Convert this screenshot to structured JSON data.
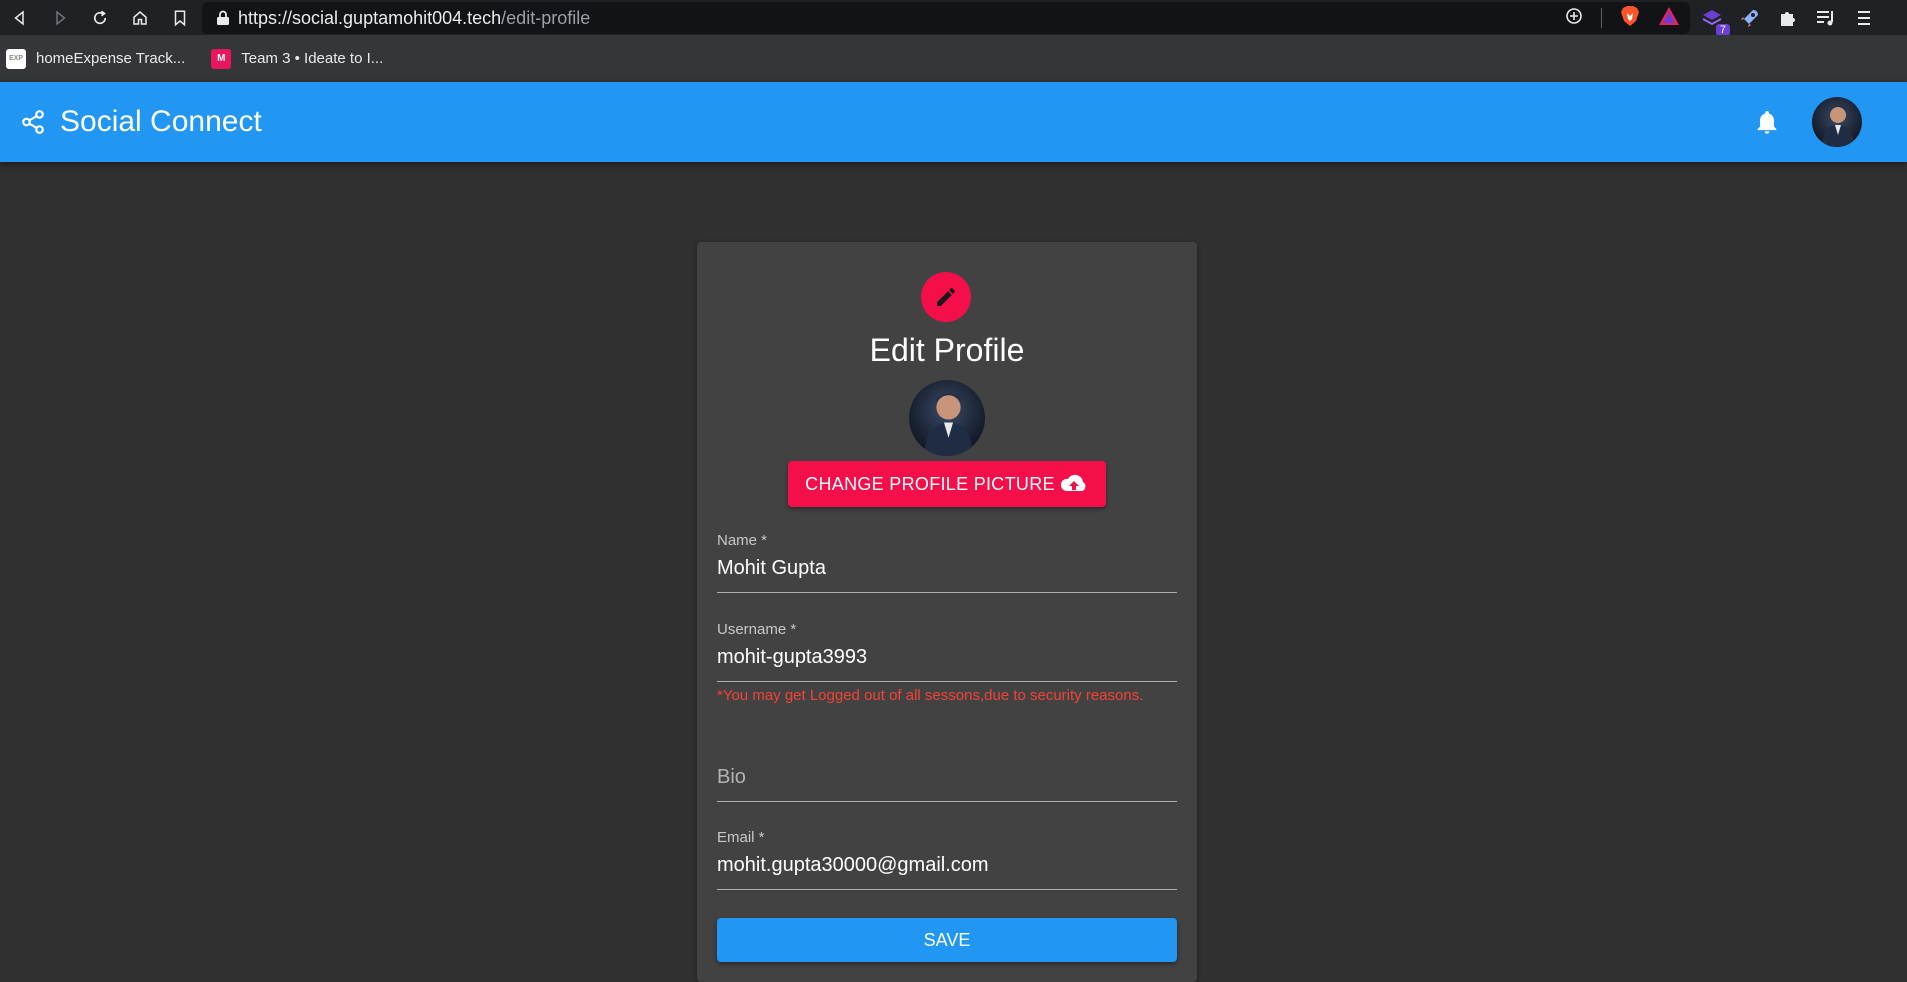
{
  "browser": {
    "url_host": "https://social.guptamohit004.tech",
    "url_path": "/edit-profile",
    "extension_badge": "7",
    "bookmarks": [
      {
        "label": "homeExpense Track...",
        "icon_text": "EXP"
      },
      {
        "label": "Team 3 • Ideate to I...",
        "icon_text": "M"
      }
    ]
  },
  "appbar": {
    "title": "Social Connect"
  },
  "form": {
    "title": "Edit Profile",
    "change_picture_label": "CHANGE PROFILE PICTURE",
    "name_label": "Name *",
    "name_value": "Mohit Gupta",
    "username_label": "Username *",
    "username_value": "mohit-gupta3993",
    "username_help": "*You may get Logged out of all sessons,due to security reasons.",
    "bio_placeholder": "Bio",
    "email_label": "Email *",
    "email_value": "mohit.gupta30000@gmail.com",
    "save_label": "SAVE"
  },
  "colors": {
    "appbar": "#2196f3",
    "accent": "#f50f4a",
    "background": "#303030",
    "card": "#424242",
    "error": "#f44336"
  }
}
